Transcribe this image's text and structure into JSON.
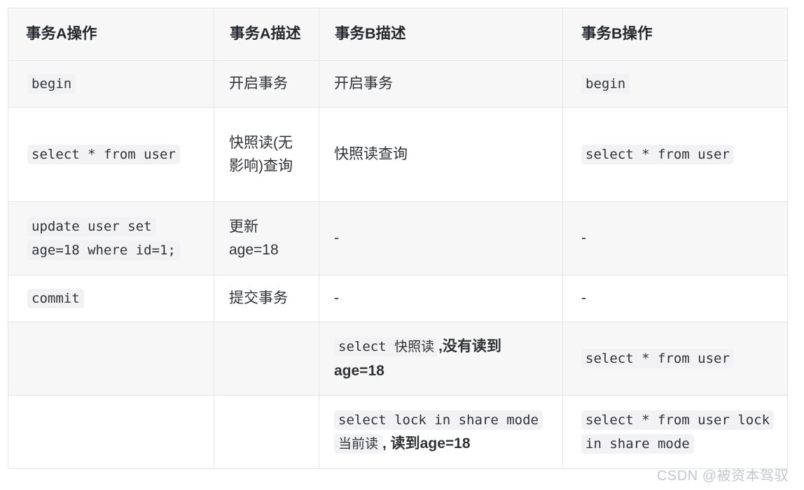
{
  "table": {
    "headers": [
      "事务A操作",
      "事务A描述",
      "事务B描述",
      "事务B操作"
    ],
    "rows": [
      {
        "a_op_code": "begin",
        "a_desc": "开启事务",
        "b_desc": "开启事务",
        "b_op_code": "begin"
      },
      {
        "a_op_code": "select * from user",
        "a_desc": "快照读(无影响)查询",
        "b_desc": "快照读查询",
        "b_op_code": "select * from user"
      },
      {
        "a_op_code": "update user set age=18 where id=1;",
        "a_desc": "更新age=18",
        "b_desc": "-",
        "b_op_code": "-"
      },
      {
        "a_op_code": "commit",
        "a_desc": "提交事务",
        "b_desc": "-",
        "b_op_code": "-"
      },
      {
        "a_op_code": "",
        "a_desc": "",
        "b_desc_code": "select 快照读",
        "b_desc_text": ",没有读到age=18",
        "b_op_code": "select * from user"
      },
      {
        "a_op_code": "",
        "a_desc": "",
        "b_desc_code": "select lock in share mode当前读",
        "b_desc_text": ", 读到age=18",
        "b_op_code": "select * from user lock in share mode"
      }
    ]
  },
  "watermark": "CSDN @被资本驾驭",
  "colors": {
    "header_bg": "#f7f7f8",
    "stripe_bg": "#f7f7f8",
    "row_bg": "#ffffff",
    "border": "#e3e4e8",
    "code_bg": "#f2f2f4",
    "text": "#2f3236",
    "watermark": "#c2c7cf"
  }
}
